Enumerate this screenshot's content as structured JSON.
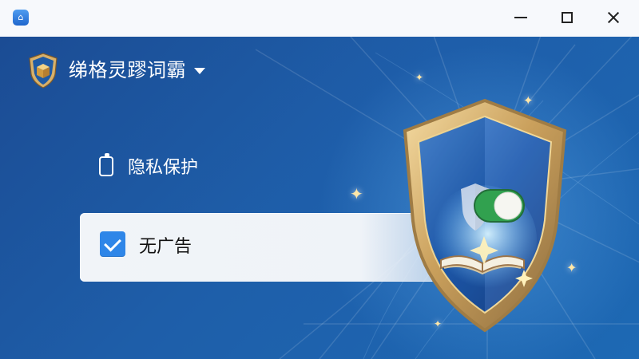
{
  "window": {
    "title_icon": "app-logo-icon",
    "controls": [
      "minimize-icon",
      "maximize-icon",
      "close-icon"
    ]
  },
  "brand": {
    "title": "绨格灵蹘词霸",
    "logo_icon": "shield-box-icon",
    "dropdown_icon": "chevron-down-icon"
  },
  "privacy": {
    "label": "隐私保护",
    "icon": "battery-icon"
  },
  "no_ads": {
    "label": "无广告",
    "checked": true,
    "icon": "checkbox-checked-icon"
  },
  "illustration": {
    "toggle_on": true,
    "icons": [
      "shield-icon",
      "toggle-switch-icon",
      "book-icon",
      "sparkle-icon"
    ]
  },
  "colors": {
    "background": "#1e5ea9",
    "accent_blue": "#2f86e8",
    "toggle_green": "#31a14f",
    "shield_gold": "#d8b56e"
  }
}
